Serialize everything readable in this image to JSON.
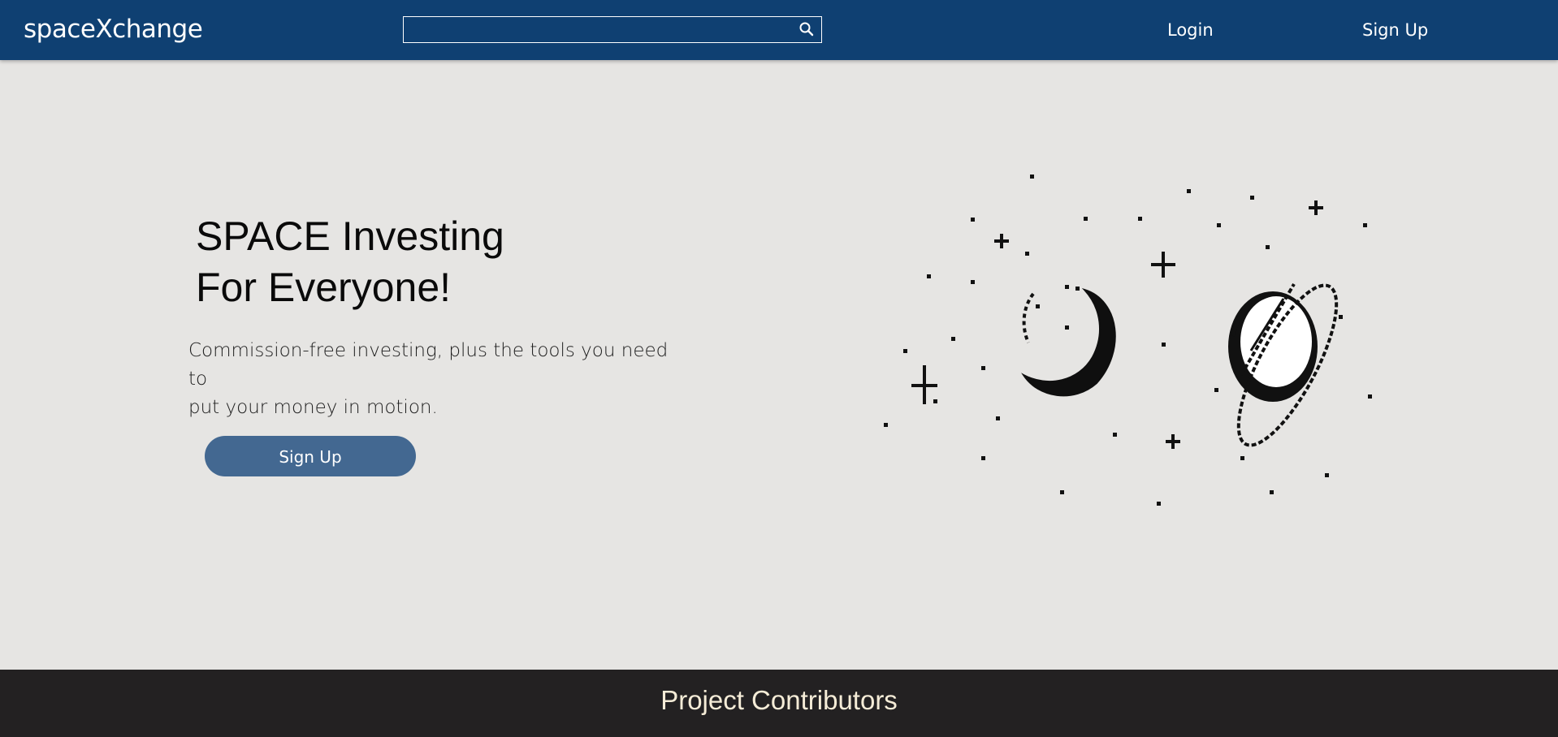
{
  "header": {
    "brand": "spaceXchange",
    "search": {
      "placeholder": "",
      "value": "",
      "icon": "search-icon"
    },
    "nav": {
      "login_label": "Login",
      "signup_label": "Sign Up"
    },
    "background_color": "#0f4072"
  },
  "hero": {
    "title_line1": "SPACE Investing",
    "title_line2": "For Everyone!",
    "subtitle_line1": "Commission-free investing, plus the tools you need to",
    "subtitle_line2": "put your money in motion.",
    "cta_label": "Sign Up",
    "cta_color": "#436891",
    "illustration": "pixel-art-moon-planet-stars"
  },
  "footer": {
    "title": "Project Contributors",
    "background_color": "#232122"
  }
}
